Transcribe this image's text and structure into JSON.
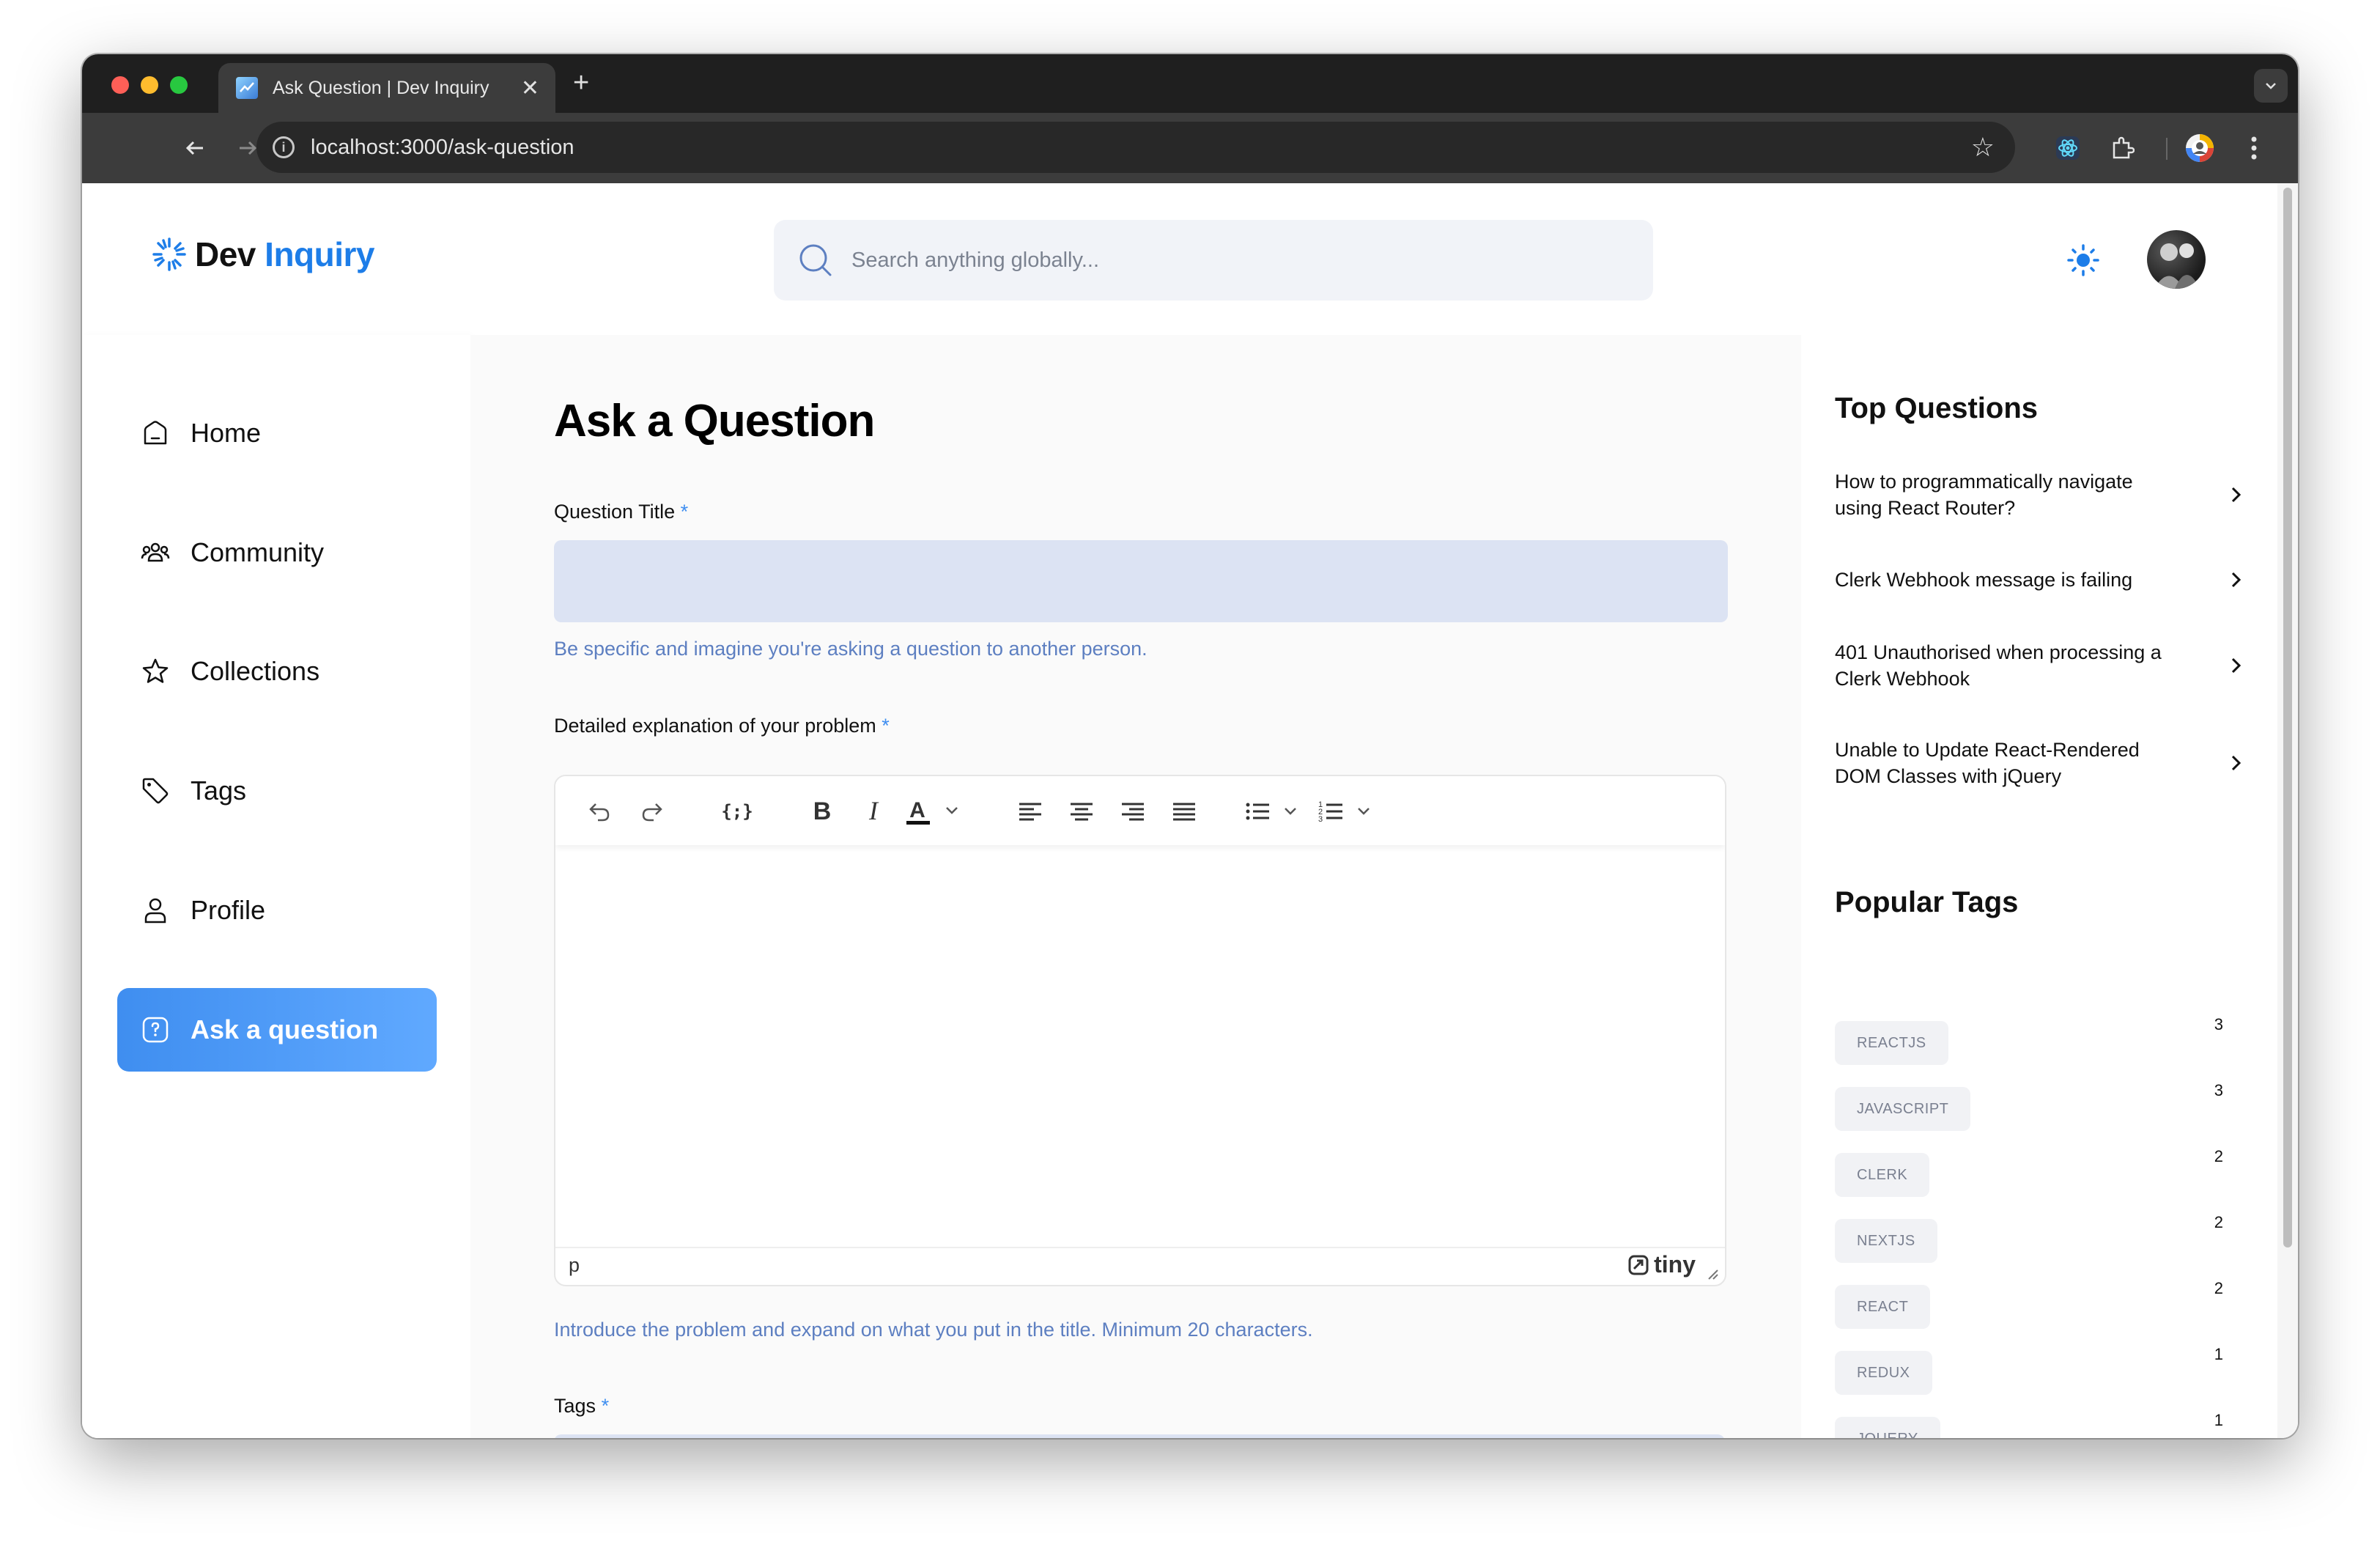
{
  "browser": {
    "tab_title": "Ask Question | Dev Inquiry",
    "url": "localhost:3000/ask-question"
  },
  "header": {
    "logo_dev": "Dev",
    "logo_inquiry": "Inquiry",
    "search_placeholder": "Search anything globally..."
  },
  "sidebar": {
    "items": [
      {
        "label": "Home",
        "icon": "home-icon"
      },
      {
        "label": "Community",
        "icon": "users-icon"
      },
      {
        "label": "Collections",
        "icon": "star-icon"
      },
      {
        "label": "Tags",
        "icon": "tag-icon"
      },
      {
        "label": "Profile",
        "icon": "user-icon"
      },
      {
        "label": "Ask a question",
        "icon": "question-icon",
        "active": true
      }
    ]
  },
  "form": {
    "heading": "Ask a Question",
    "title_label": "Question Title",
    "required_mark": "*",
    "title_value": "",
    "title_hint": "Be specific and imagine you're asking a question to another person.",
    "explanation_label": "Detailed explanation of your problem",
    "editor_status": "p",
    "editor_brand": "tiny",
    "explanation_hint": "Introduce the problem and expand on what you put in the title. Minimum 20 characters.",
    "tags_label": "Tags"
  },
  "right_sidebar": {
    "top_questions_title": "Top Questions",
    "top_questions": [
      "How to programmatically navigate using React Router?",
      "Clerk Webhook message is failing",
      "401 Unauthorised when processing a Clerk Webhook",
      "Unable to Update React-Rendered DOM Classes with jQuery"
    ],
    "popular_tags_title": "Popular Tags",
    "popular_tags": [
      {
        "name": "REACTJS",
        "count": "3"
      },
      {
        "name": "JAVASCRIPT",
        "count": "3"
      },
      {
        "name": "CLERK",
        "count": "2"
      },
      {
        "name": "NEXTJS",
        "count": "2"
      },
      {
        "name": "REACT",
        "count": "2"
      },
      {
        "name": "REDUX",
        "count": "1"
      },
      {
        "name": "JQUERY",
        "count": "1"
      }
    ]
  },
  "colors": {
    "accent": "#3f8ef0",
    "brand": "#1d7de8",
    "hint": "#5d7fc1",
    "input_bg": "#dce3f3"
  }
}
